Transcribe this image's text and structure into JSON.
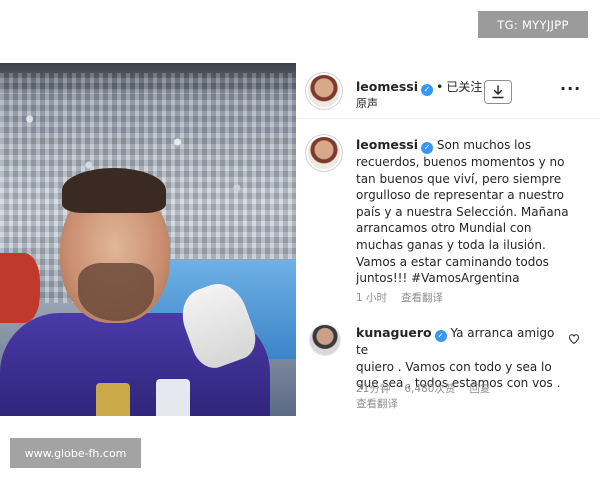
{
  "watermarks": {
    "top": "TG: MYYJJPP",
    "bottom": "www.globe-fh.com"
  },
  "post": {
    "header": {
      "username": "leomessi",
      "separator": "•",
      "follow_status": "已关注",
      "subtitle": "原声",
      "icons": {
        "download": "download-icon",
        "more": "more-options-icon",
        "verified": "verified-badge-icon"
      }
    },
    "caption": {
      "username": "leomessi",
      "lines": [
        "Son muchos los",
        "recuerdos, buenos momentos y no",
        "tan buenos que viví, pero siempre",
        "orgulloso de representar a nuestro",
        "país y a nuestra Selección. Mañana",
        "arrancamos otro Mundial con",
        "muchas ganas y toda la ilusión.",
        "Vamos a estar caminando todos",
        "juntos!!! #VamosArgentina"
      ],
      "time": "1 小时",
      "translate": "查看翻译"
    },
    "comment": {
      "username": "kunaguero",
      "lines": [
        "Ya arranca amigo te",
        "quiero . Vamos con todo y sea lo",
        "que sea , todos estamos con vos ."
      ],
      "time": "21分钟",
      "likes": "6,480次赞",
      "reply": "回复",
      "translate": "查看翻译",
      "like_icon": "heart-icon"
    }
  },
  "colors": {
    "verified": "#3897f0",
    "text": "#262626",
    "muted": "#8e8e8e",
    "watermark_bg": "#9b9b9b"
  }
}
